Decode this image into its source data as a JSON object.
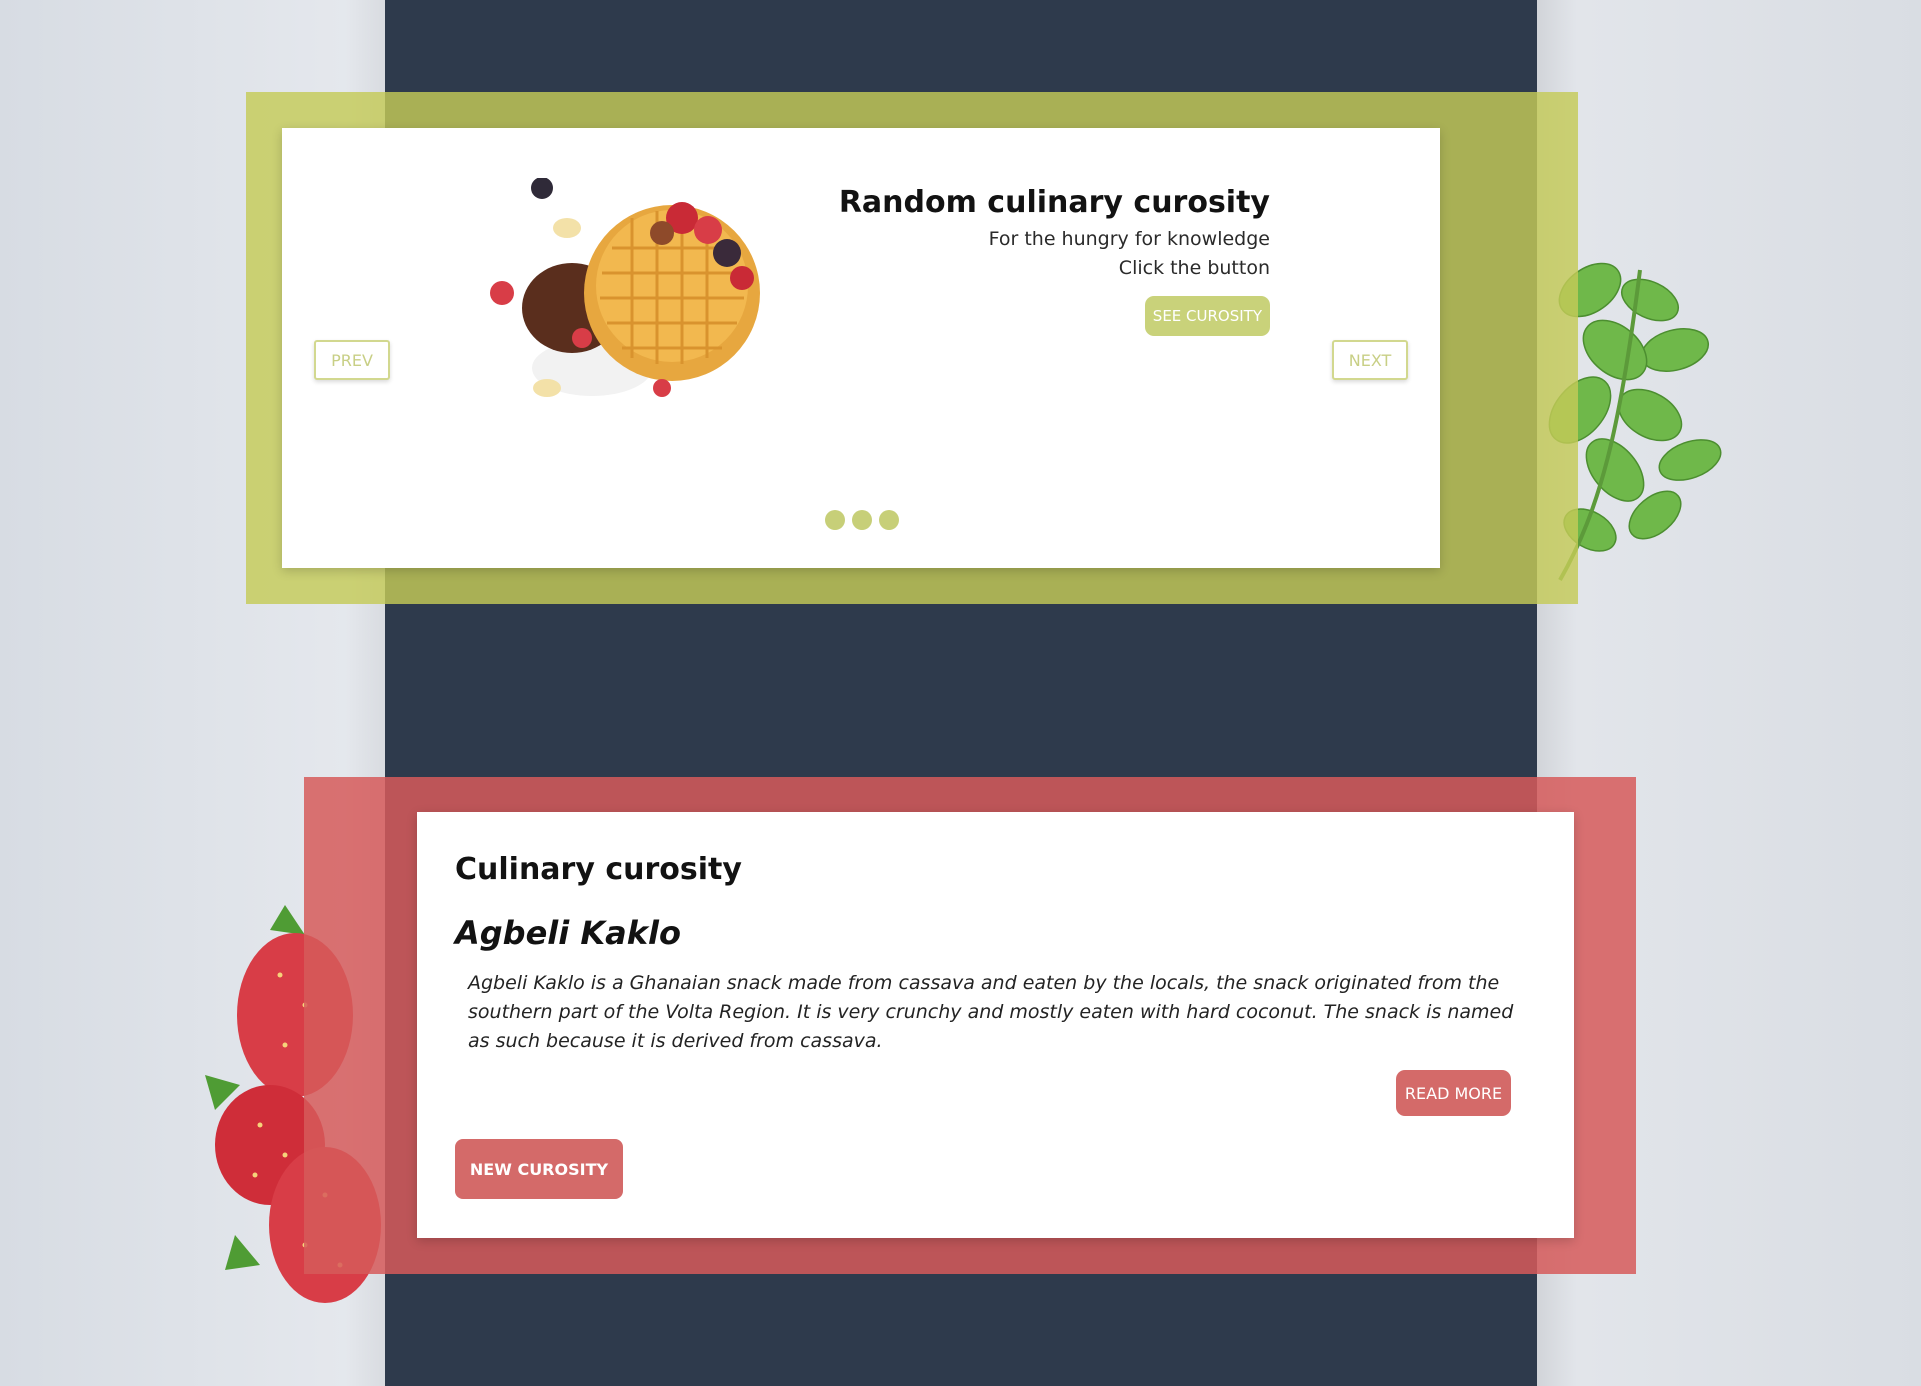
{
  "colors": {
    "page_background": "#e3e6eb",
    "column": "#2e3a4c",
    "green_accent": "#c4cb58",
    "red_accent": "#d65a5a",
    "button_green": "#c9d27a",
    "button_red": "#d46a69"
  },
  "slider": {
    "title": "Random culinary curosity",
    "subtitle_line1": "For the hungry for knowledge",
    "subtitle_line2": "Click the button",
    "cta_label": "SEE CUROSITY",
    "prev_label": "PREV",
    "next_label": "NEXT",
    "image": "waffles-with-berries-image",
    "slide_count": 3
  },
  "curiosity": {
    "heading": "Culinary curosity",
    "dish_name": "Agbeli Kaklo",
    "description": "Agbeli Kaklo is a Ghanaian snack made from cassava and eaten by the locals, the snack originated from the southern part of the Volta Region. It is very crunchy and mostly eaten with hard coconut. The snack is named as such because it is derived from cassava.",
    "read_more_label": "READ MORE",
    "new_curiosity_label": "NEW CUROSITY"
  },
  "decorations": {
    "right": "oregano-herb-image",
    "left": "strawberries-image"
  }
}
